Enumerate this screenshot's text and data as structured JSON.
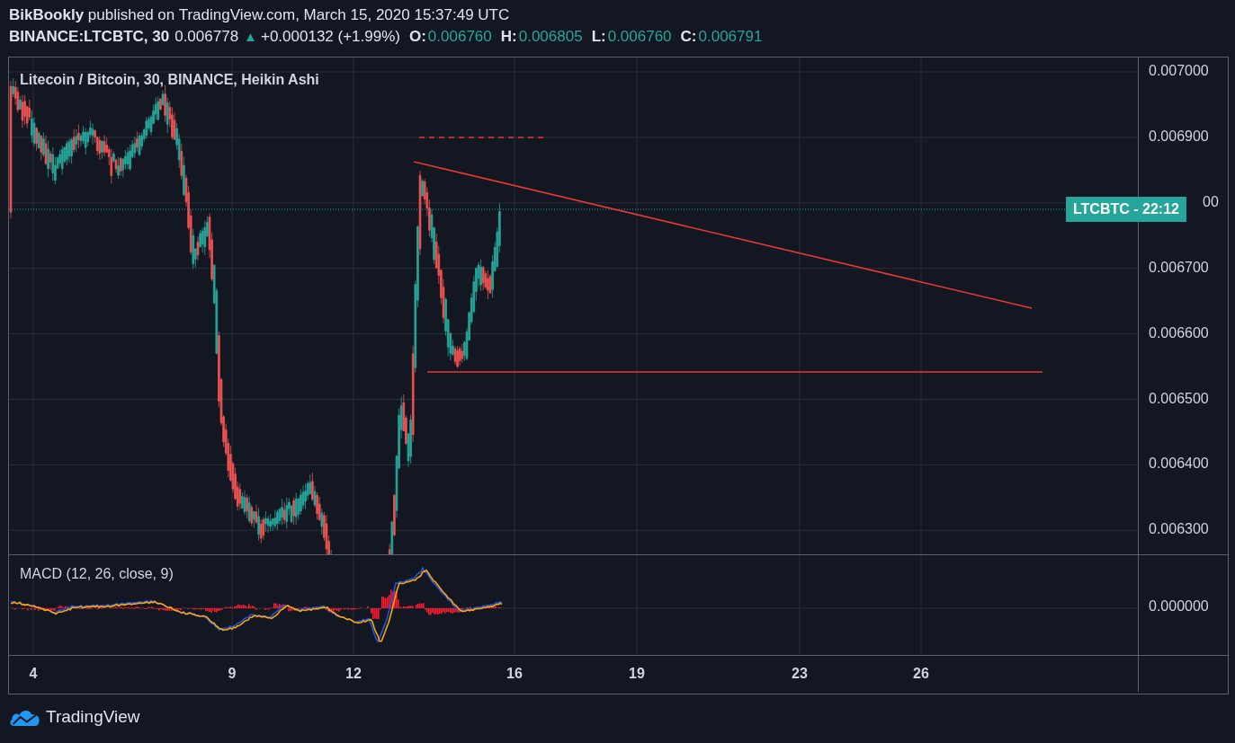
{
  "header": {
    "publisher_line": "**BikBookly** published on TradingView.com, March 15, 2020 15:37:49 UTC",
    "symbol": "BINANCE:LTCBTC, 30",
    "price": "0.006778",
    "change_icon": "▲",
    "change": "+0.000132 (+1.99%)",
    "ohlc": [
      {
        "label": "O:",
        "value": "0.006760"
      },
      {
        "label": "H:",
        "value": "0.006805"
      },
      {
        "label": "L:",
        "value": "0.006760"
      },
      {
        "label": "C:",
        "value": "0.006791"
      }
    ]
  },
  "chart": {
    "title": "Litecoin / Bitcoin, 30, BINANCE, Heikin Ashi",
    "price_ticks": [
      "0.007000",
      "0.006900",
      "00",
      "0.006700",
      "0.006600",
      "0.006500",
      "0.006400",
      "0.006300"
    ],
    "price_badge": "LTCBTC - 22:12",
    "indicator": {
      "title": "MACD (12, 26, close, 9)",
      "tick": "0.000000"
    },
    "time_ticks": [
      "4",
      "9",
      "12",
      "16",
      "19",
      "23",
      "26"
    ]
  },
  "footer": {
    "brand": "TradingView"
  }
}
